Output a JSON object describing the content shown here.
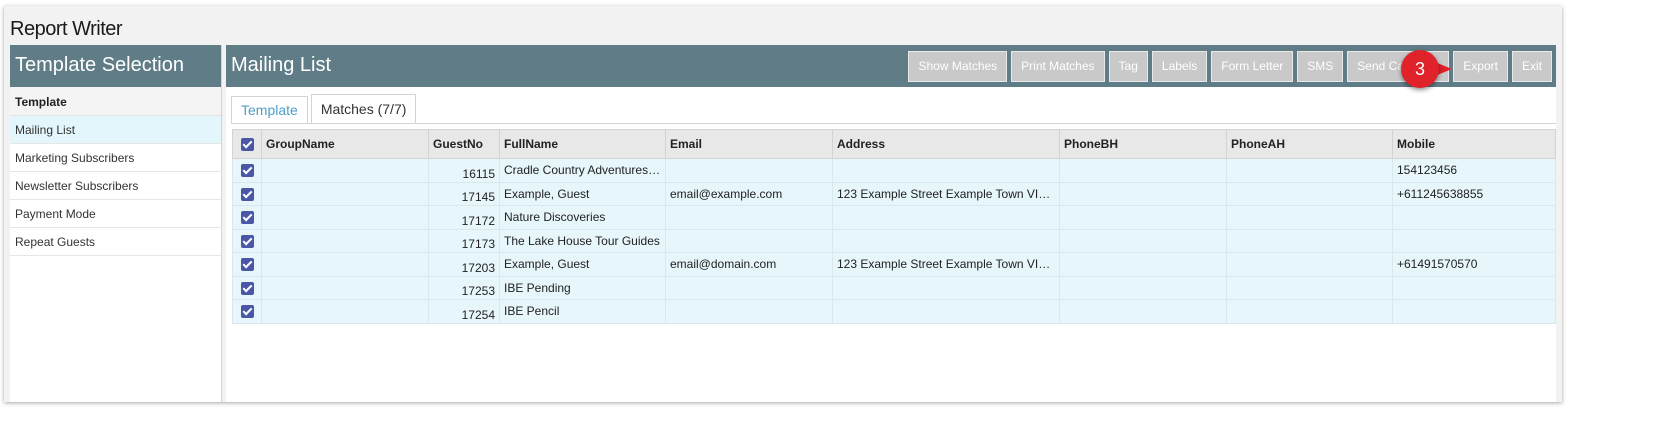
{
  "app": {
    "title": "Report Writer"
  },
  "left_panel": {
    "header": "Template Selection",
    "subheader": "Template",
    "items": [
      {
        "label": "Mailing List",
        "selected": true
      },
      {
        "label": "Marketing Subscribers",
        "selected": false
      },
      {
        "label": "Newsletter Subscribers",
        "selected": false
      },
      {
        "label": "Payment Mode",
        "selected": false
      },
      {
        "label": "Repeat Guests",
        "selected": false
      }
    ]
  },
  "main": {
    "title": "Mailing List",
    "toolbar": {
      "show_matches": "Show Matches",
      "print_matches": "Print Matches",
      "tag": "Tag",
      "labels": "Labels",
      "form_letter": "Form Letter",
      "sms": "SMS",
      "send_ca": "Send Ca",
      "export": "Export",
      "exit": "Exit"
    },
    "marker": "3",
    "tabs": [
      {
        "label": "Template",
        "active": false
      },
      {
        "label": "Matches (7/7)",
        "active": true
      }
    ],
    "table": {
      "columns": [
        "GroupName",
        "GuestNo",
        "FullName",
        "Email",
        "Address",
        "PhoneBH",
        "PhoneAH",
        "Mobile"
      ],
      "rows": [
        [
          "",
          "16115",
          "Cradle Country Adventures,...",
          "",
          "",
          "",
          "",
          "154123456"
        ],
        [
          "",
          "17145",
          "Example, Guest",
          "email@example.com",
          "123 Example Street Example Town VIC ...",
          "",
          "",
          "+611245638855"
        ],
        [
          "",
          "17172",
          "Nature Discoveries",
          "",
          "",
          "",
          "",
          ""
        ],
        [
          "",
          "17173",
          "The Lake House Tour Guides",
          "",
          "",
          "",
          "",
          ""
        ],
        [
          "",
          "17203",
          "Example, Guest",
          "email@domain.com",
          "123 Example Street Example Town VIC ...",
          "",
          "",
          "+61491570570"
        ],
        [
          "",
          "17253",
          "IBE Pending",
          "",
          "",
          "",
          "",
          ""
        ],
        [
          "",
          "17254",
          "IBE Pencil",
          "",
          "",
          "",
          "",
          ""
        ]
      ]
    }
  },
  "colors": {
    "header_bg": "#607d87",
    "selected_row": "#e3f6fb",
    "button_bg": "#c9c9c9",
    "marker": "#e0222a",
    "checkbox": "#4a57a6"
  }
}
